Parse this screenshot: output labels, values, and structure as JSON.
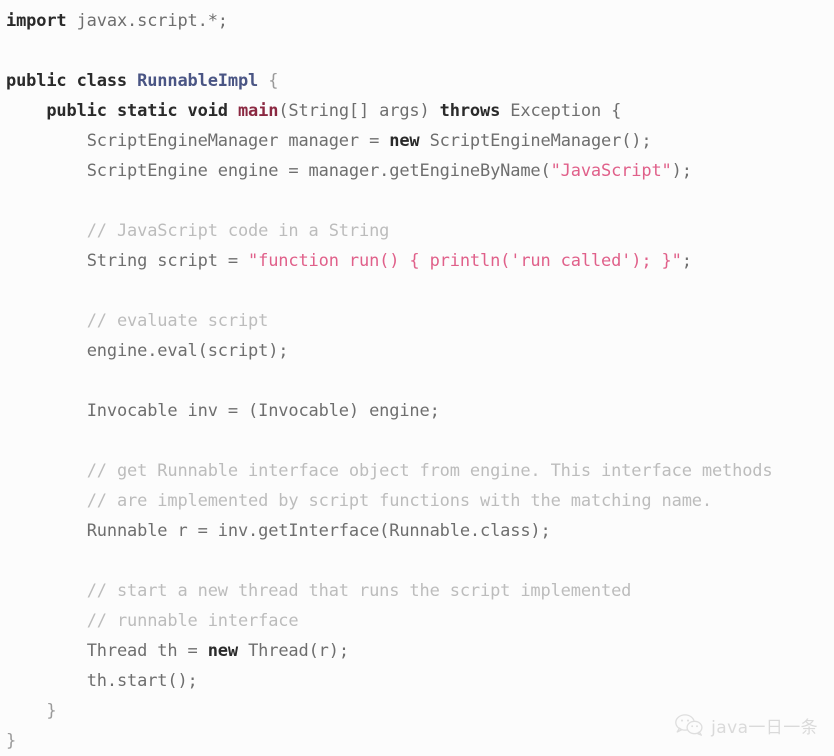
{
  "meta": {
    "background_color": "#fcfcfc",
    "language": "Java",
    "font_size_px": 17,
    "line_height_px": 30
  },
  "colors": {
    "body_text": "#6e6e6e",
    "keyword": "#2a2a2a",
    "class_name": "#4a5584",
    "method_name": "#8b2942",
    "string_literal": "#e0608a",
    "comment": "#bcbcbc",
    "watermark": "#8d8d8d"
  },
  "code": {
    "lines": [
      {
        "id": "line-1",
        "indent": 0,
        "tokens": [
          {
            "t": "kw",
            "v": "import"
          },
          {
            "t": "plain",
            "v": " javax.script.*;"
          }
        ]
      },
      {
        "id": "line-2",
        "indent": 0,
        "blank": true,
        "tokens": []
      },
      {
        "id": "line-3",
        "indent": 0,
        "tokens": [
          {
            "t": "kw",
            "v": "public class "
          },
          {
            "t": "type",
            "v": "RunnableImpl"
          },
          {
            "t": "punct",
            "v": " {"
          }
        ]
      },
      {
        "id": "line-4",
        "indent": 1,
        "tokens": [
          {
            "t": "kw",
            "v": "public static void "
          },
          {
            "t": "method",
            "v": "main"
          },
          {
            "t": "plain",
            "v": "(String[] args) "
          },
          {
            "t": "kw",
            "v": "throws"
          },
          {
            "t": "plain",
            "v": " Exception {"
          }
        ]
      },
      {
        "id": "line-5",
        "indent": 2,
        "tokens": [
          {
            "t": "plain",
            "v": "ScriptEngineManager manager = "
          },
          {
            "t": "kw",
            "v": "new"
          },
          {
            "t": "plain",
            "v": " ScriptEngineManager();"
          }
        ]
      },
      {
        "id": "line-6",
        "indent": 2,
        "tokens": [
          {
            "t": "plain",
            "v": "ScriptEngine engine = manager.getEngineByName("
          },
          {
            "t": "str",
            "v": "\"JavaScript\""
          },
          {
            "t": "plain",
            "v": ");"
          }
        ]
      },
      {
        "id": "line-7",
        "indent": 0,
        "blank": true,
        "tokens": []
      },
      {
        "id": "line-8",
        "indent": 2,
        "tokens": [
          {
            "t": "comment",
            "v": "// JavaScript code in a String"
          }
        ]
      },
      {
        "id": "line-9",
        "indent": 2,
        "tokens": [
          {
            "t": "plain",
            "v": "String script = "
          },
          {
            "t": "str",
            "v": "\"function run() { println('run called'); }\""
          },
          {
            "t": "plain",
            "v": ";"
          }
        ]
      },
      {
        "id": "line-10",
        "indent": 0,
        "blank": true,
        "tokens": []
      },
      {
        "id": "line-11",
        "indent": 2,
        "tokens": [
          {
            "t": "comment",
            "v": "// evaluate script"
          }
        ]
      },
      {
        "id": "line-12",
        "indent": 2,
        "tokens": [
          {
            "t": "plain",
            "v": "engine.eval(script);"
          }
        ]
      },
      {
        "id": "line-13",
        "indent": 0,
        "blank": true,
        "tokens": []
      },
      {
        "id": "line-14",
        "indent": 2,
        "tokens": [
          {
            "t": "plain",
            "v": "Invocable inv = (Invocable) engine;"
          }
        ]
      },
      {
        "id": "line-15",
        "indent": 0,
        "blank": true,
        "tokens": []
      },
      {
        "id": "line-16",
        "indent": 2,
        "tokens": [
          {
            "t": "comment",
            "v": "// get Runnable interface object from engine. This interface methods"
          }
        ]
      },
      {
        "id": "line-17",
        "indent": 2,
        "tokens": [
          {
            "t": "comment",
            "v": "// are implemented by script functions with the matching name."
          }
        ]
      },
      {
        "id": "line-18",
        "indent": 2,
        "tokens": [
          {
            "t": "plain",
            "v": "Runnable r = inv.getInterface(Runnable.class);"
          }
        ]
      },
      {
        "id": "line-19",
        "indent": 0,
        "blank": true,
        "tokens": []
      },
      {
        "id": "line-20",
        "indent": 2,
        "tokens": [
          {
            "t": "comment",
            "v": "// start a new thread that runs the script implemented"
          }
        ]
      },
      {
        "id": "line-21",
        "indent": 2,
        "tokens": [
          {
            "t": "comment",
            "v": "// runnable interface"
          }
        ]
      },
      {
        "id": "line-22",
        "indent": 2,
        "tokens": [
          {
            "t": "plain",
            "v": "Thread th = "
          },
          {
            "t": "kw",
            "v": "new"
          },
          {
            "t": "plain",
            "v": " Thread(r);"
          }
        ]
      },
      {
        "id": "line-23",
        "indent": 2,
        "tokens": [
          {
            "t": "plain",
            "v": "th.start();"
          }
        ]
      },
      {
        "id": "line-24",
        "indent": 1,
        "tokens": [
          {
            "t": "punct",
            "v": "}"
          }
        ]
      },
      {
        "id": "line-25",
        "indent": 0,
        "tokens": [
          {
            "t": "punct",
            "v": "}"
          }
        ]
      }
    ]
  },
  "watermark": {
    "icon": "wechat-icon",
    "text": "java一日一条"
  }
}
